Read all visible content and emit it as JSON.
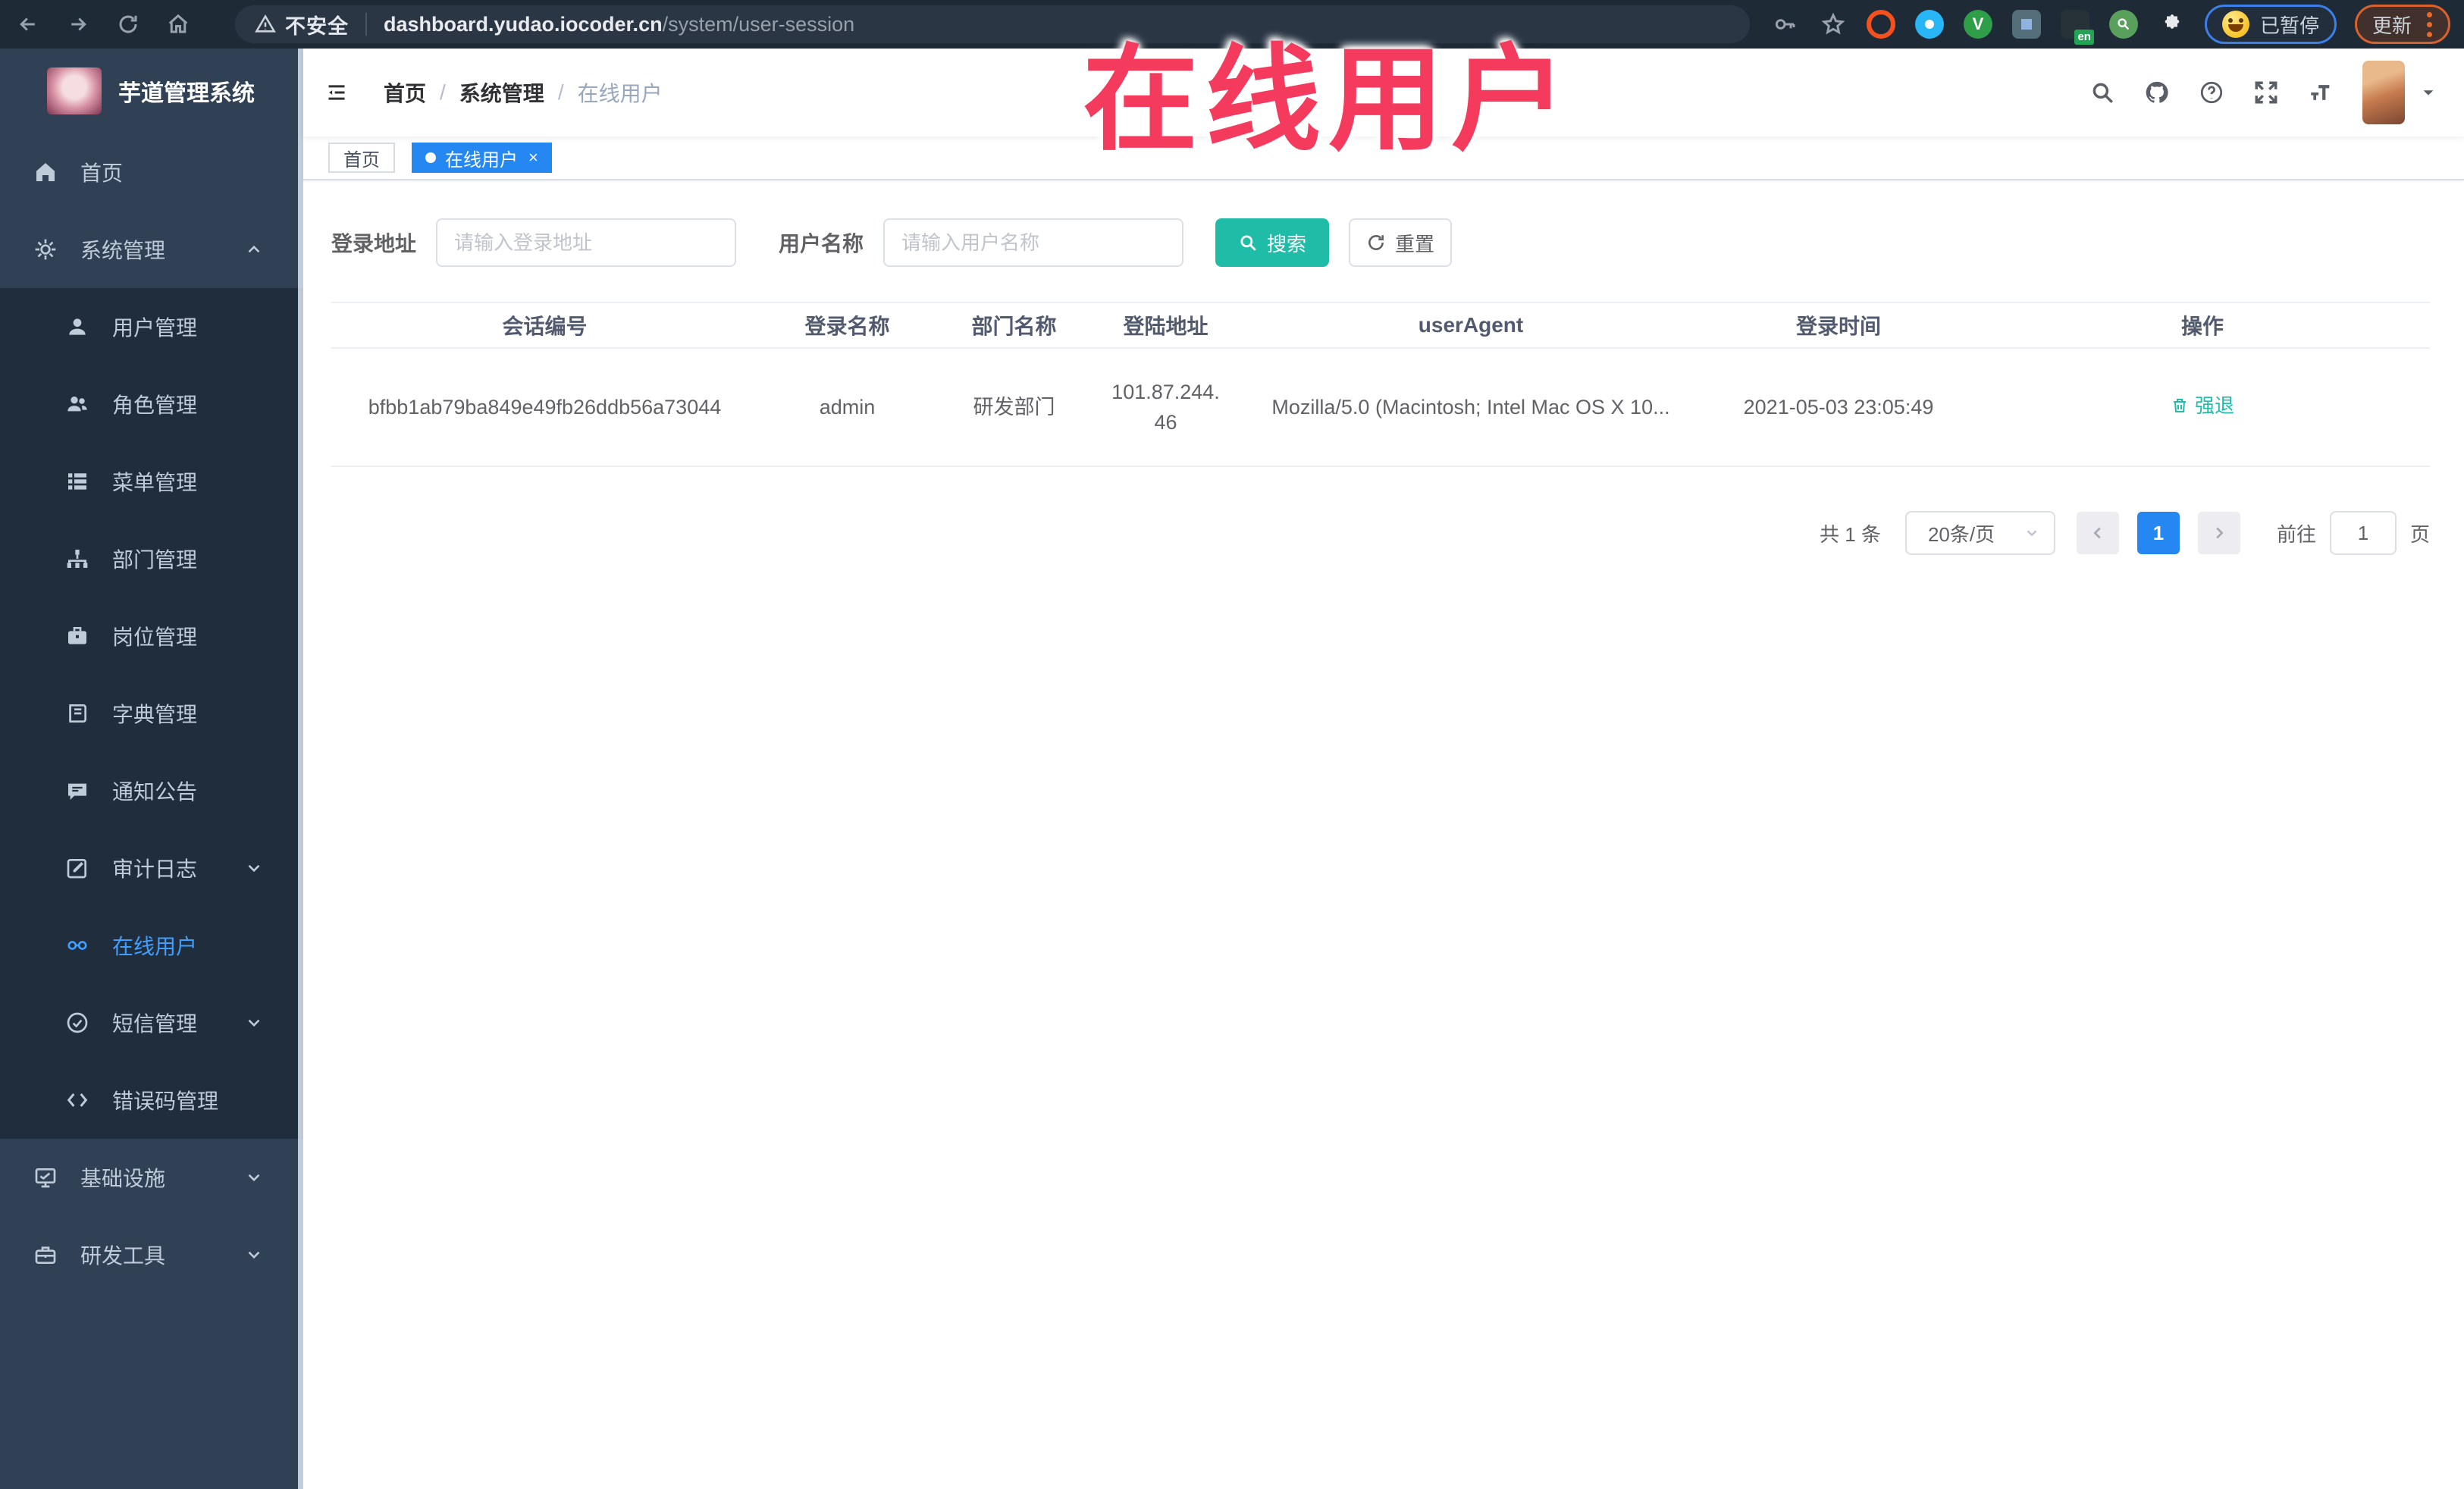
{
  "browser": {
    "security_label": "不安全",
    "url_domain": "dashboard.yudao.iocoder.cn",
    "url_path": "/system/user-session",
    "ext_badge": "en",
    "paused_label": "已暂停",
    "update_label": "更新"
  },
  "watermark": "在线用户",
  "sidebar": {
    "logo_title": "芋道管理系统",
    "items": [
      {
        "label": "首页",
        "icon": "home-icon",
        "level": "root"
      },
      {
        "label": "系统管理",
        "icon": "gear-icon",
        "level": "root",
        "chevron": "up"
      },
      {
        "label": "用户管理",
        "icon": "user-icon",
        "level": "sub"
      },
      {
        "label": "角色管理",
        "icon": "users-icon",
        "level": "sub"
      },
      {
        "label": "菜单管理",
        "icon": "menu-list-icon",
        "level": "sub"
      },
      {
        "label": "部门管理",
        "icon": "org-tree-icon",
        "level": "sub"
      },
      {
        "label": "岗位管理",
        "icon": "briefcase-icon",
        "level": "sub"
      },
      {
        "label": "字典管理",
        "icon": "dictionary-icon",
        "level": "sub"
      },
      {
        "label": "通知公告",
        "icon": "announcement-icon",
        "level": "sub"
      },
      {
        "label": "审计日志",
        "icon": "audit-log-icon",
        "level": "sub",
        "chevron": "down"
      },
      {
        "label": "在线用户",
        "icon": "online-user-icon",
        "level": "sub",
        "active": true
      },
      {
        "label": "短信管理",
        "icon": "sms-icon",
        "level": "sub",
        "chevron": "down"
      },
      {
        "label": "错误码管理",
        "icon": "code-icon",
        "level": "sub"
      },
      {
        "label": "基础设施",
        "icon": "infrastructure-icon",
        "level": "root",
        "chevron": "down"
      },
      {
        "label": "研发工具",
        "icon": "dev-tools-icon",
        "level": "root",
        "chevron": "down"
      }
    ]
  },
  "breadcrumb": {
    "sep": "/",
    "items": [
      "首页",
      "系统管理",
      "在线用户"
    ]
  },
  "tags": [
    {
      "label": "首页",
      "active": false
    },
    {
      "label": "在线用户",
      "active": true
    }
  ],
  "filters": {
    "address_label": "登录地址",
    "address_placeholder": "请输入登录地址",
    "username_label": "用户名称",
    "username_placeholder": "请输入用户名称",
    "search_label": "搜索",
    "reset_label": "重置"
  },
  "table": {
    "columns": [
      "会话编号",
      "登录名称",
      "部门名称",
      "登陆地址",
      "userAgent",
      "登录时间",
      "操作"
    ],
    "rows": [
      {
        "session_id": "bfbb1ab79ba849e49fb26ddb56a73044",
        "username": "admin",
        "dept": "研发部门",
        "ip_line1": "101.87.244.",
        "ip_line2": "46",
        "user_agent": "Mozilla/5.0 (Macintosh; Intel Mac OS X 10...",
        "login_time": "2021-05-03 23:05:49",
        "action_label": "强退"
      }
    ]
  },
  "pagination": {
    "total": "共 1 条",
    "page_size": "20条/页",
    "current_page": "1",
    "goto_label": "前往",
    "goto_value": "1",
    "page_unit": "页"
  },
  "colors": {
    "accent_blue": "#2487F2",
    "sidebar_active": "#409EFF",
    "teal_button": "#1FBDA7",
    "watermark_red": "#F43B5E",
    "sidebar_bg": "#304156",
    "submenu_bg": "#1F2D3D"
  }
}
